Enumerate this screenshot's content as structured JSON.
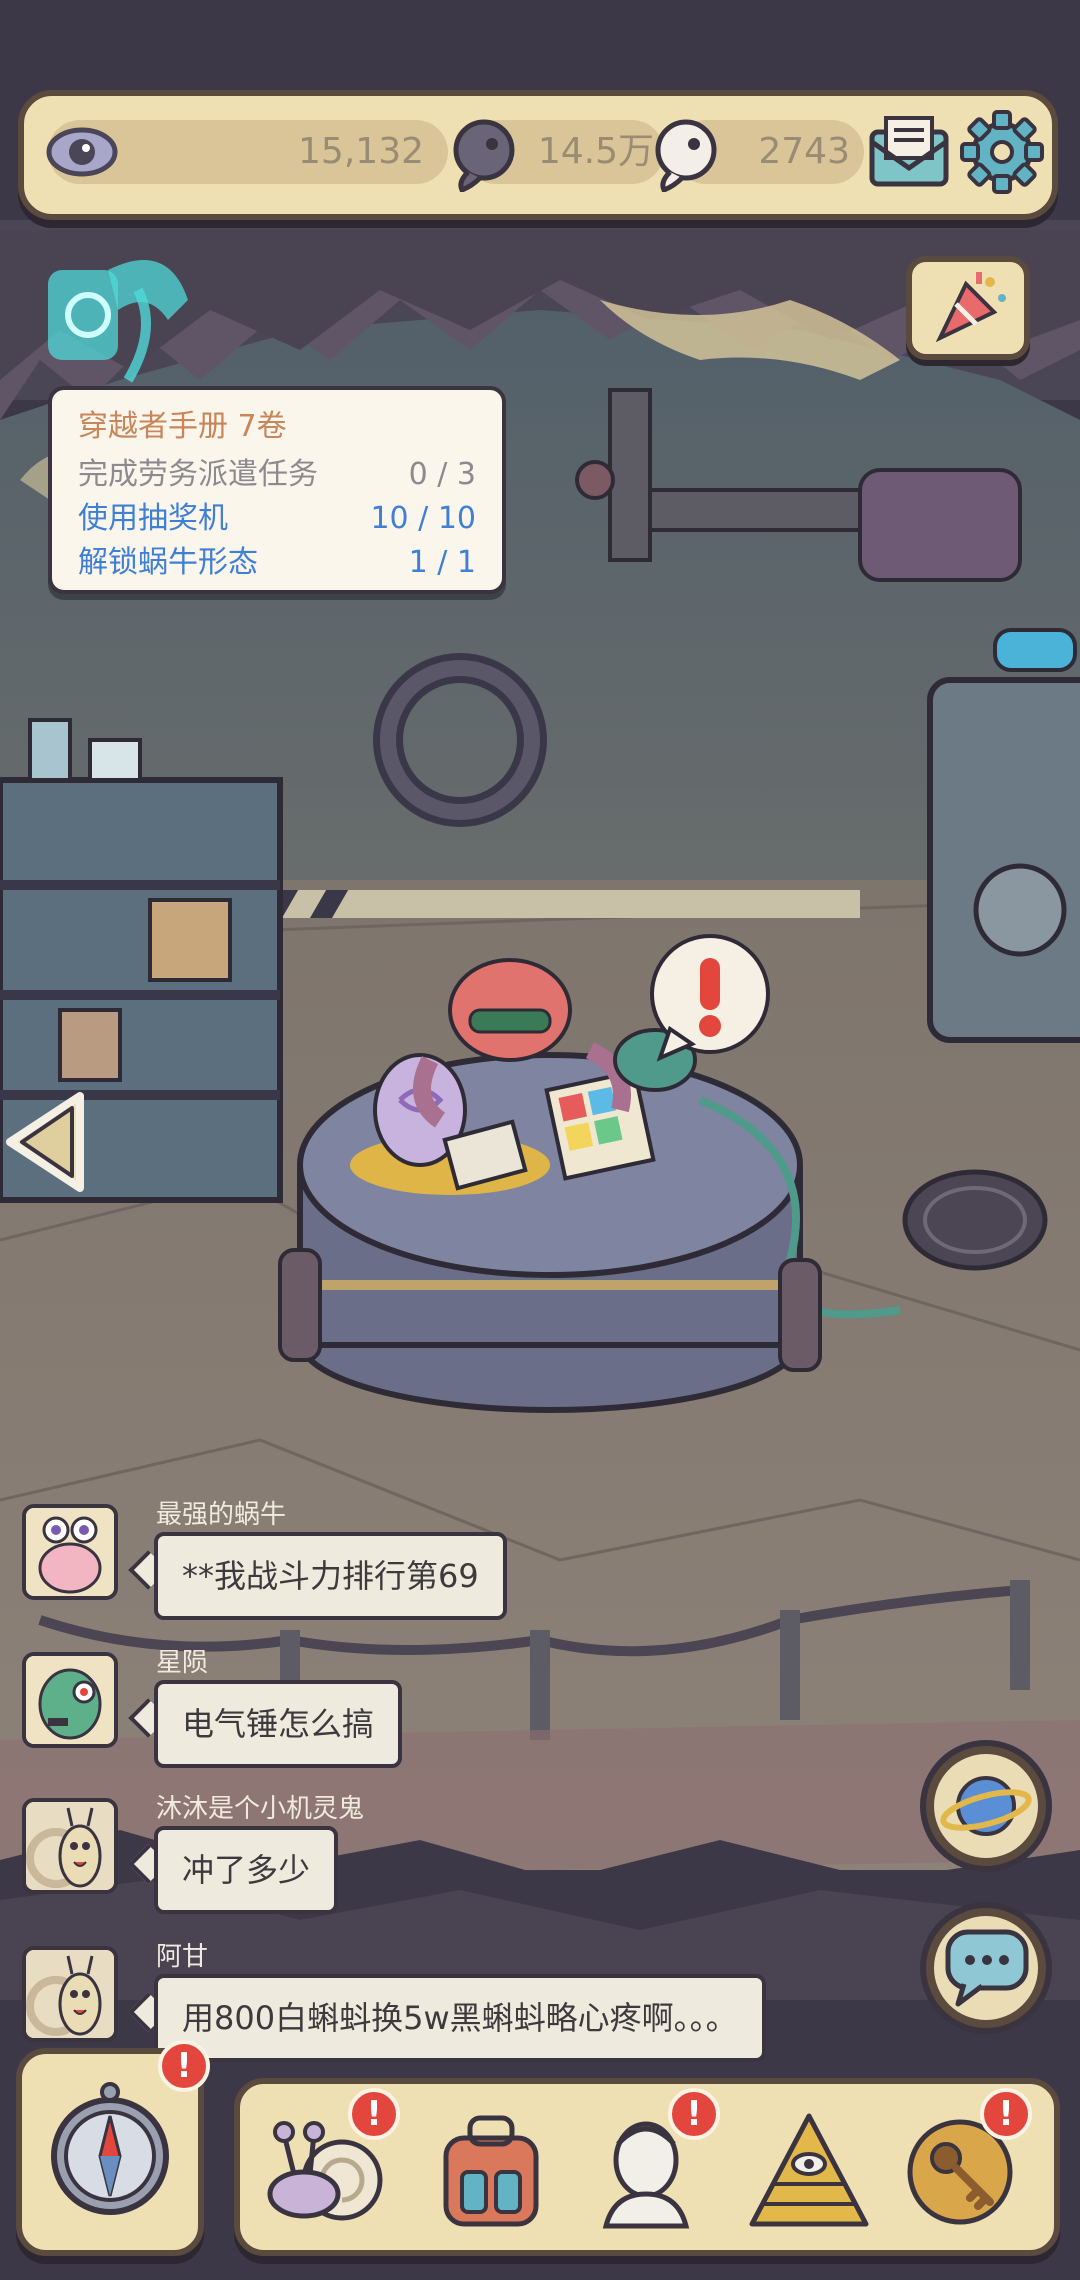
{
  "resources": {
    "vision": "15,132",
    "bubbles_dark": "14.5万",
    "bubbles_light": "2743"
  },
  "icons": {
    "eye": "eye-icon",
    "dark_bubble": "dark-tadpole-icon",
    "light_bubble": "white-tadpole-icon",
    "mail": "mail-icon",
    "settings": "gear-icon",
    "party": "party-popper-icon",
    "back": "left-arrow-icon",
    "planet": "planet-icon",
    "chat": "chat-icon",
    "compass": "compass-icon"
  },
  "task_panel": {
    "title": "穿越者手册 7卷",
    "tasks": [
      {
        "label": "完成劳务派遣任务",
        "progress": "0 / 3",
        "done": false
      },
      {
        "label": "使用抽奖机",
        "progress": "10 / 10",
        "done": true
      },
      {
        "label": "解锁蜗牛形态",
        "progress": "1 / 1",
        "done": true
      }
    ]
  },
  "scene": {
    "alert_mark": "!"
  },
  "chat": [
    {
      "name": "最强的蜗牛",
      "message": "**我战斗力排行第69"
    },
    {
      "name": "星陨",
      "message": "电气锤怎么搞"
    },
    {
      "name": "沐沐是个小机灵鬼",
      "message": "冲了多少"
    },
    {
      "name": "阿甘",
      "message": "用800白蝌蚪换5w黑蝌蚪略心疼啊。。。"
    }
  ],
  "badges": {
    "mark": "!"
  },
  "colors": {
    "panel_bg": "#efe0b4",
    "panel_border": "#5b4a3e",
    "task_title": "#c9865a",
    "task_pending": "#8c8a8e",
    "task_done": "#3f7fd6",
    "badge_red": "#e3463d"
  }
}
